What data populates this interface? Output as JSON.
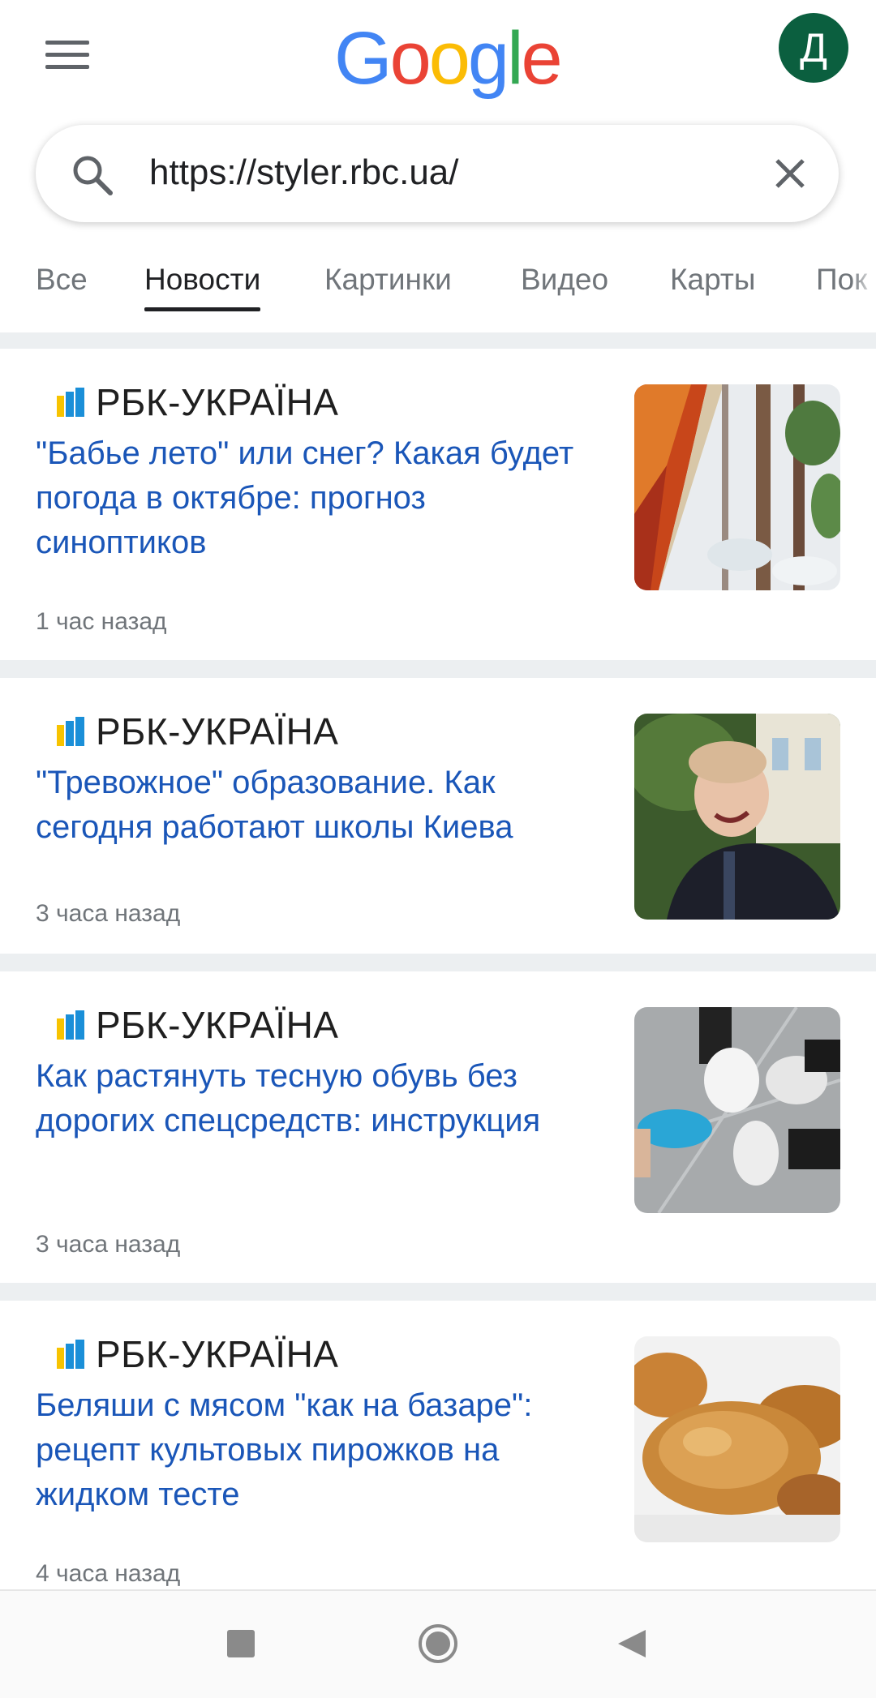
{
  "header": {
    "logo_letters": [
      {
        "char": "G",
        "color": "#4285F4"
      },
      {
        "char": "o",
        "color": "#EA4335"
      },
      {
        "char": "o",
        "color": "#FBBC05"
      },
      {
        "char": "g",
        "color": "#4285F4"
      },
      {
        "char": "l",
        "color": "#34A853"
      },
      {
        "char": "e",
        "color": "#EA4335"
      }
    ],
    "avatar_initial": "Д",
    "avatar_color": "#0b5f3f",
    "menu_icon": "hamburger-icon"
  },
  "search": {
    "value": "https://styler.rbc.ua/",
    "search_icon": "search-icon",
    "clear_icon": "close-icon"
  },
  "tabs": [
    {
      "label": "Все",
      "active": false
    },
    {
      "label": "Новости",
      "active": true
    },
    {
      "label": "Картинки",
      "active": false
    },
    {
      "label": "Видео",
      "active": false
    },
    {
      "label": "Карты",
      "active": false
    },
    {
      "label": "Пок",
      "active": false
    }
  ],
  "articles": [
    {
      "source": "РБК-УКРАЇНА",
      "title": "\"Бабье лето\" или снег? Какая будет погода в октябре: прогноз синоптиков",
      "time": "1 час назад",
      "image": "autumn-winter-forest"
    },
    {
      "source": "РБК-УКРАЇНА",
      "title": "\"Тревожное\" образование. Как сегодня работают школы Киева",
      "time": "3 часа назад",
      "image": "smiling-schoolchild"
    },
    {
      "source": "РБК-УКРАЇНА",
      "title": "Как растянуть тесную обувь без дорогих спецсредств: инструкция",
      "time": "3 часа назад",
      "image": "sneakers-on-pavement"
    },
    {
      "source": "РБК-УКРАЇНА",
      "title": "Беляши с мясом \"как на базаре\": рецепт культовых пирожков на жидком тесте",
      "time": "4 часа назад",
      "image": "fried-pies"
    }
  ],
  "colors": {
    "link": "#1a56b8",
    "rbc_logo_blue": "#1a8fd8",
    "rbc_logo_yellow": "#f7c300"
  },
  "navbar": [
    "recents-square-icon",
    "home-circle-icon",
    "back-triangle-icon"
  ]
}
